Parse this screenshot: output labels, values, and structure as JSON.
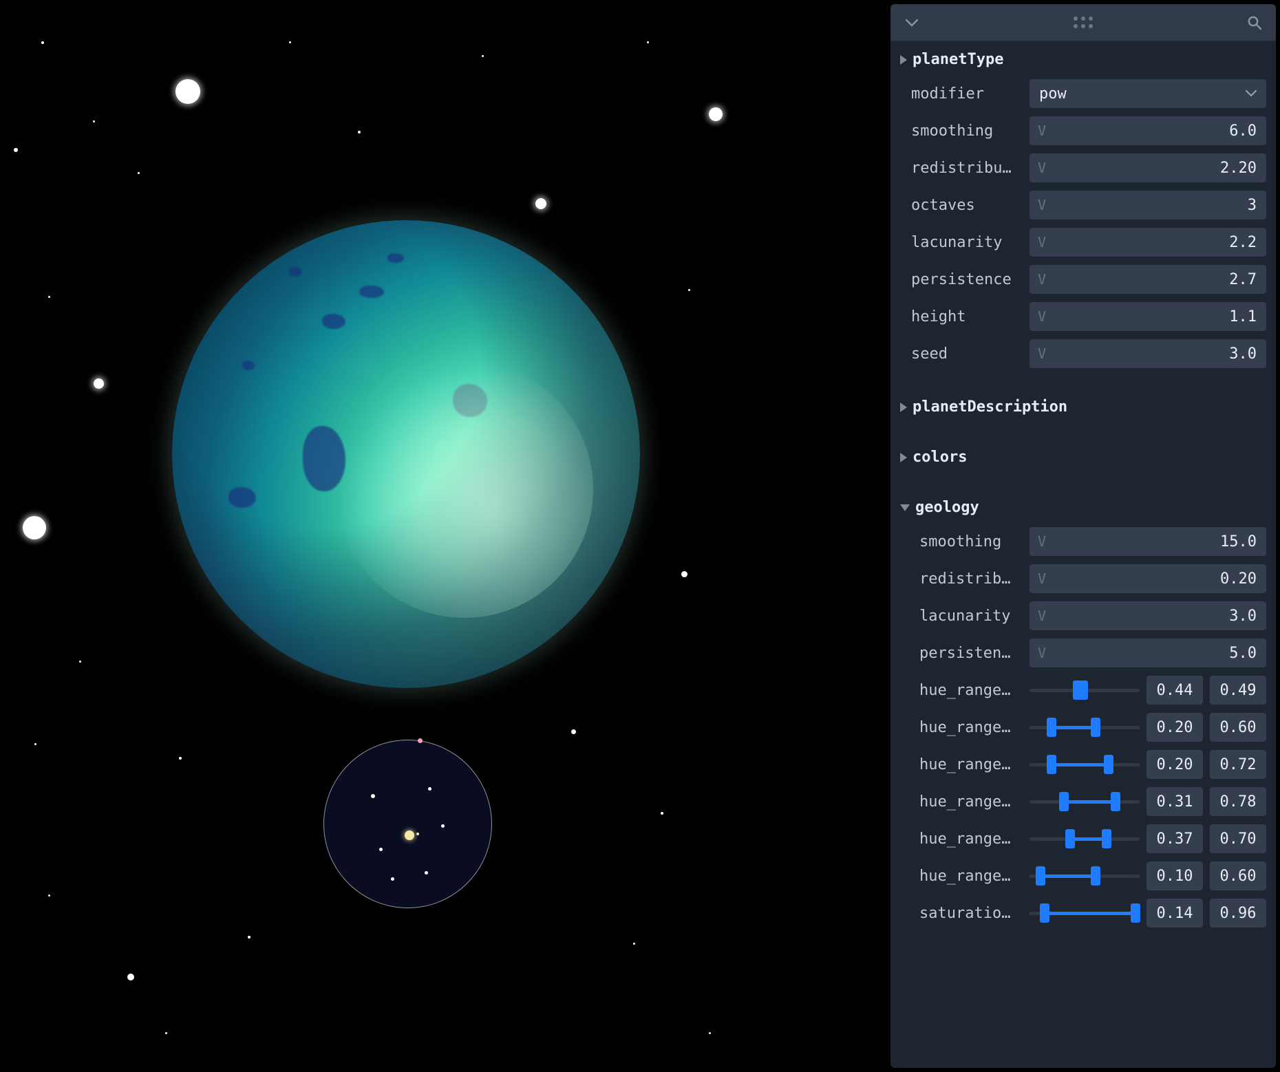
{
  "sections": {
    "planetType": {
      "title": "planetType",
      "modifier_label": "modifier",
      "modifier_value": "pow",
      "params": {
        "smoothing": {
          "label": "smoothing",
          "value": "6.0"
        },
        "redistribution": {
          "label": "redistribu…",
          "value": "2.20"
        },
        "octaves": {
          "label": "octaves",
          "value": "3"
        },
        "lacunarity": {
          "label": "lacunarity",
          "value": "2.2"
        },
        "persistence": {
          "label": "persistence",
          "value": "2.7"
        },
        "height": {
          "label": "height",
          "value": "1.1"
        },
        "seed": {
          "label": "seed",
          "value": "3.0"
        }
      }
    },
    "planetDescription": {
      "title": "planetDescription"
    },
    "colors": {
      "title": "colors"
    },
    "geology": {
      "title": "geology",
      "params": {
        "smoothing": {
          "label": "smoothing",
          "value": "15.0"
        },
        "redistribution": {
          "label": "redistrib…",
          "value": "0.20"
        },
        "lacunarity": {
          "label": "lacunarity",
          "value": "3.0"
        },
        "persistence": {
          "label": "persisten…",
          "value": "5.0"
        }
      },
      "ranges": [
        {
          "label": "hue_range…",
          "lo": "0.44",
          "hi": "0.49"
        },
        {
          "label": "hue_range…",
          "lo": "0.20",
          "hi": "0.60"
        },
        {
          "label": "hue_range…",
          "lo": "0.20",
          "hi": "0.72"
        },
        {
          "label": "hue_range…",
          "lo": "0.31",
          "hi": "0.78"
        },
        {
          "label": "hue_range…",
          "lo": "0.37",
          "hi": "0.70"
        },
        {
          "label": "hue_range…",
          "lo": "0.10",
          "hi": "0.60"
        },
        {
          "label": "saturatio…",
          "lo": "0.14",
          "hi": "0.96"
        }
      ]
    }
  },
  "colors": {
    "panel_bg": "#1c2530",
    "field_bg": "#343e4e",
    "accent": "#1f7cff"
  }
}
